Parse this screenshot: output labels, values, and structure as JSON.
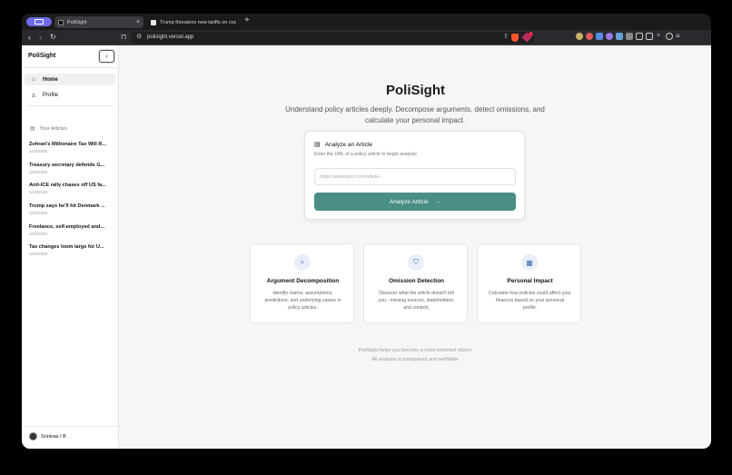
{
  "browser": {
    "tabs": [
      {
        "title": "PoliSight",
        "active": true
      },
      {
        "title": "Trump threatens new tariffs on countries tha",
        "active": false
      }
    ],
    "new_tab": "+",
    "address": "polisight.vercel.app",
    "nav": {
      "back": "‹",
      "forward": "›",
      "reload": "↻",
      "bookmark": "⊓"
    }
  },
  "sidebar": {
    "brand": "PoliSight",
    "collapse": "‹",
    "nav": [
      {
        "label": "Home",
        "icon": "home-icon",
        "selected": true
      },
      {
        "label": "Profile",
        "icon": "user-icon",
        "selected": false
      }
    ],
    "section_title": "Your Articles",
    "articles": [
      {
        "title": "Zohran's Millionaire Tax Will R...",
        "date": "1/18/2026"
      },
      {
        "title": "Treasury secretary defends G...",
        "date": "1/18/2026"
      },
      {
        "title": "Anti-ICE rally chases off US fa...",
        "date": "1/18/2026"
      },
      {
        "title": "Trump says he'll hit Denmark ...",
        "date": "1/18/2026"
      },
      {
        "title": "Freelance, self-employed and...",
        "date": "1/18/2026"
      },
      {
        "title": "Tax changes loom large for U...",
        "date": "1/18/2026"
      }
    ],
    "user": "Srinivas I B"
  },
  "main": {
    "title": "PoliSight",
    "subtitle": "Understand policy articles deeply. Decompose arguments, detect omissions, and calculate your personal impact.",
    "analyze": {
      "heading": "Analyze an Article",
      "subheading": "Enter the URL of a policy article to begin analysis",
      "placeholder": "https://example.com/article...",
      "value": "",
      "button": "Analyze Article",
      "button_arrow": "→"
    },
    "features": [
      {
        "title": "Argument Decomposition",
        "desc": "Identify claims, assumptions, predictions, and underlying values in policy articles.",
        "icon": "search-icon"
      },
      {
        "title": "Omission Detection",
        "desc": "Discover what the article doesn't tell you - missing sources, stakeholders, and context.",
        "icon": "shield-icon"
      },
      {
        "title": "Personal Impact",
        "desc": "Calculate how policies could affect your finances based on your personal profile.",
        "icon": "calculator-icon"
      }
    ],
    "footer_lines": [
      "PoliSight helps you become a more informed citizen.",
      "All analysis is transparent and verifiable."
    ]
  },
  "colors": {
    "accent": "#4a8e84",
    "space": "#6d6cf0",
    "brave": "#fb542b"
  }
}
